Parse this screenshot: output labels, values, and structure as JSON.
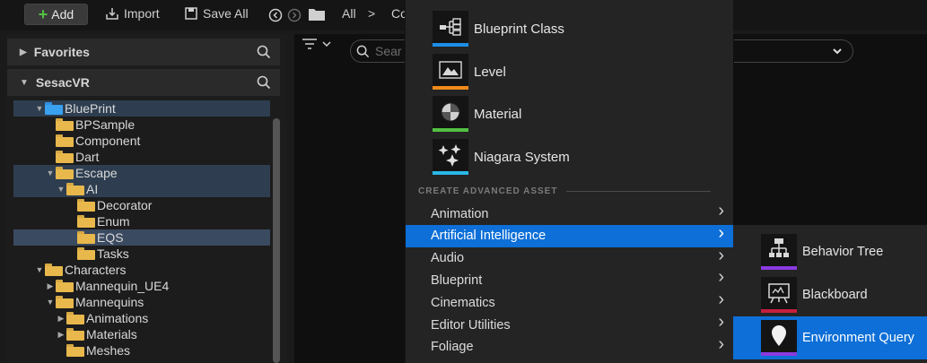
{
  "toolbar": {
    "add_label": "Add",
    "import_label": "Import",
    "save_all_label": "Save All",
    "breadcrumb_all": "All",
    "breadcrumb_next": "Co"
  },
  "left_panel": {
    "favorites_label": "Favorites",
    "project_label": "SesacVR",
    "tree": [
      {
        "label": "BluePrint",
        "depth": 1,
        "open": true,
        "selected": true,
        "color": "blue"
      },
      {
        "label": "BPSample",
        "depth": 2
      },
      {
        "label": "Component",
        "depth": 2
      },
      {
        "label": "Dart",
        "depth": 2
      },
      {
        "label": "Escape",
        "depth": 2,
        "open": true,
        "selected": true
      },
      {
        "label": "AI",
        "depth": 3,
        "open": true,
        "selected": true
      },
      {
        "label": "Decorator",
        "depth": 4
      },
      {
        "label": "Enum",
        "depth": 4
      },
      {
        "label": "EQS",
        "depth": 4,
        "selected": true
      },
      {
        "label": "Tasks",
        "depth": 4
      },
      {
        "label": "Characters",
        "depth": 1,
        "open": true
      },
      {
        "label": "Mannequin_UE4",
        "depth": 2,
        "collapsed": true
      },
      {
        "label": "Mannequins",
        "depth": 2,
        "open": true
      },
      {
        "label": "Animations",
        "depth": 3,
        "collapsed": true
      },
      {
        "label": "Materials",
        "depth": 3,
        "collapsed": true
      },
      {
        "label": "Meshes",
        "depth": 3
      }
    ]
  },
  "content": {
    "search_placeholder": "Sear"
  },
  "menu": {
    "basic_assets": [
      {
        "label": "Blueprint Class",
        "color": "#1e8fe8",
        "icon": "blueprint-class-icon"
      },
      {
        "label": "Level",
        "color": "#f08a1a",
        "icon": "level-icon"
      },
      {
        "label": "Material",
        "color": "#52c043",
        "icon": "material-icon"
      },
      {
        "label": "Niagara System",
        "color": "#2ab8e8",
        "icon": "niagara-system-icon"
      }
    ],
    "advanced_header": "CREATE ADVANCED ASSET",
    "categories": [
      {
        "label": "Animation",
        "active": false
      },
      {
        "label": "Artificial Intelligence",
        "active": true
      },
      {
        "label": "Audio",
        "active": false
      },
      {
        "label": "Blueprint",
        "active": false
      },
      {
        "label": "Cinematics",
        "active": false
      },
      {
        "label": "Editor Utilities",
        "active": false
      },
      {
        "label": "Foliage",
        "active": false
      }
    ]
  },
  "submenu": {
    "items": [
      {
        "label": "Behavior Tree",
        "color": "#8a3ae0",
        "icon": "behavior-tree-icon",
        "active": false
      },
      {
        "label": "Blackboard",
        "color": "#c81e3e",
        "icon": "blackboard-icon",
        "active": false
      },
      {
        "label": "Environment Query",
        "color": "#8a3ae0",
        "icon": "environment-query-icon",
        "active": true
      }
    ]
  },
  "colors": {
    "accent": "#0d6fd7",
    "add_green": "#52c043",
    "folder": "#e8b84c"
  }
}
